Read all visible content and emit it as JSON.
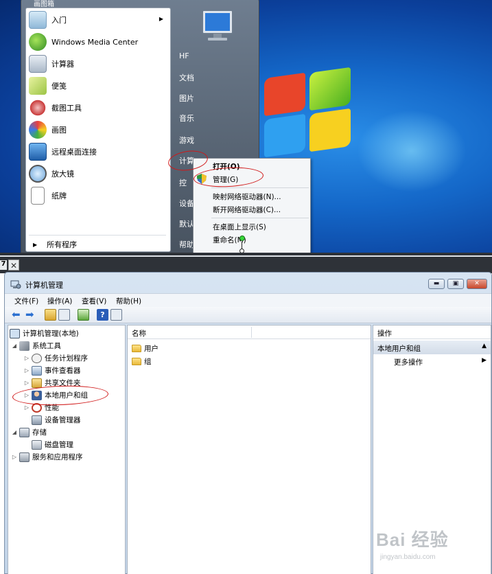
{
  "start_menu": {
    "title": "画图箱",
    "programs": [
      {
        "label": "入门",
        "icon": "getting-started-icon",
        "has_arrow": true
      },
      {
        "label": "Windows Media Center",
        "icon": "media-center-icon"
      },
      {
        "label": "计算器",
        "icon": "calculator-icon"
      },
      {
        "label": "便笺",
        "icon": "sticky-notes-icon"
      },
      {
        "label": "截图工具",
        "icon": "snipping-tool-icon"
      },
      {
        "label": "画图",
        "icon": "paint-icon"
      },
      {
        "label": "远程桌面连接",
        "icon": "remote-desktop-icon"
      },
      {
        "label": "放大镜",
        "icon": "magnifier-icon"
      },
      {
        "label": "纸牌",
        "icon": "solitaire-icon"
      }
    ],
    "all_programs": "所有程序",
    "right_items": [
      "HF",
      "文档",
      "图片",
      "音乐",
      "游戏",
      "计算",
      "控",
      "设备",
      "默认",
      "帮助"
    ]
  },
  "context_menu": {
    "items": [
      "打开(O)",
      "管理(G)",
      "映射网络驱动器(N)...",
      "断开网络驱动器(C)...",
      "在桌面上显示(S)",
      "重命名(M)"
    ]
  },
  "tab": {
    "number": "7",
    "close": "✕"
  },
  "window": {
    "title": "计算机管理",
    "menu": [
      "文件(F)",
      "操作(A)",
      "查看(V)",
      "帮助(H)"
    ],
    "tree": [
      {
        "label": "计算机管理(本地)",
        "level": 0,
        "expander": ""
      },
      {
        "label": "系统工具",
        "level": 1,
        "expander": "◢"
      },
      {
        "label": "任务计划程序",
        "level": 2,
        "expander": "▷"
      },
      {
        "label": "事件查看器",
        "level": 2,
        "expander": "▷"
      },
      {
        "label": "共享文件夹",
        "level": 2,
        "expander": "▷"
      },
      {
        "label": "本地用户和组",
        "level": 2,
        "expander": "▷"
      },
      {
        "label": "性能",
        "level": 2,
        "expander": "▷"
      },
      {
        "label": "设备管理器",
        "level": 2,
        "expander": ""
      },
      {
        "label": "存储",
        "level": 1,
        "expander": "◢"
      },
      {
        "label": "磁盘管理",
        "level": 2,
        "expander": ""
      },
      {
        "label": "服务和应用程序",
        "level": 1,
        "expander": "▷"
      }
    ],
    "list_header": "名称",
    "list_items": [
      "用户",
      "组"
    ],
    "actions": {
      "header": "操作",
      "group": "本地用户和组",
      "more": "更多操作"
    }
  },
  "watermark": {
    "main": "Bai 经验",
    "sub": "jingyan.baidu.com"
  },
  "colors": {
    "annotation": "#d01818",
    "desktop": "#1467c8"
  }
}
